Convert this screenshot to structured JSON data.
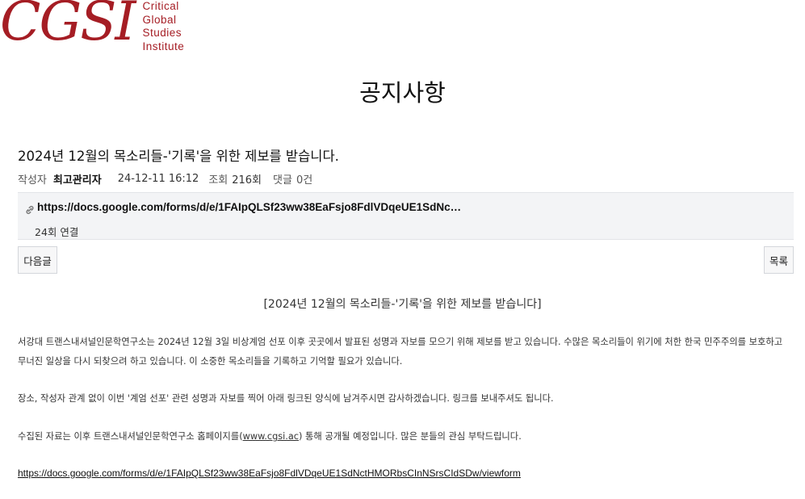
{
  "header": {
    "logo_mark": "CGSI",
    "logo_words": [
      "Critical",
      "Global",
      "Studies",
      "Institute"
    ]
  },
  "page_title": "공지사항",
  "post": {
    "title": "2024년 12월의 목소리들-'기록'을 위한 제보를 받습니다.",
    "author_label": "작성자",
    "author": "최고관리자",
    "date": "24-12-11 16:12",
    "views_label": "조회",
    "views": "216회",
    "comments_label": "댓글",
    "comments": "0건",
    "link": {
      "url": "https://docs.google.com/forms/d/e/1FAIpQLSf23ww38EaFsjo8FdlVDqeUE1SdNc…",
      "count": "24회 연결"
    }
  },
  "buttons": {
    "next": "다음글",
    "list": "목록"
  },
  "content": {
    "heading": "[2024년 12월의 목소리들-'기록'을 위한 제보를 받습니다]",
    "paragraph1": "서강대 트랜스내셔널인문학연구소는 2024년 12월 3일 비상계엄 선포 이후 곳곳에서 발표된 성명과 자보를 모으기 위해 제보를 받고 있습니다. 수많은 목소리들이 위기에 처한 한국 민주주의를 보호하고 무너진 일상을 다시 되찾으려 하고 있습니다. 이 소중한 목소리들을 기록하고 기억할 필요가 있습니다.",
    "paragraph2": "장소, 작성자 관계 없이 이번 '계엄 선포' 관련 성명과 자보를 찍어 아래 링크된 양식에 남겨주시면 감사하겠습니다. 링크를 보내주셔도 됩니다.",
    "paragraph3_before": "수집된 자료는 이후 트랜스내셔널인문학연구소 홈페이지를(",
    "paragraph3_site": "www.cgsi.ac",
    "paragraph3_after": ") 통해 공개될 예정입니다. 많은 분들의 관심 부탁드립니다.",
    "form_url": "https://docs.google.com/forms/d/e/1FAIpQLSf23ww38EaFsjo8FdlVDqeUE1SdNctHMORbsCInNSrsCIdSDw/viewform"
  },
  "colors": {
    "brand": "#a51d24",
    "link_box_bg": "#f3f4f6"
  }
}
